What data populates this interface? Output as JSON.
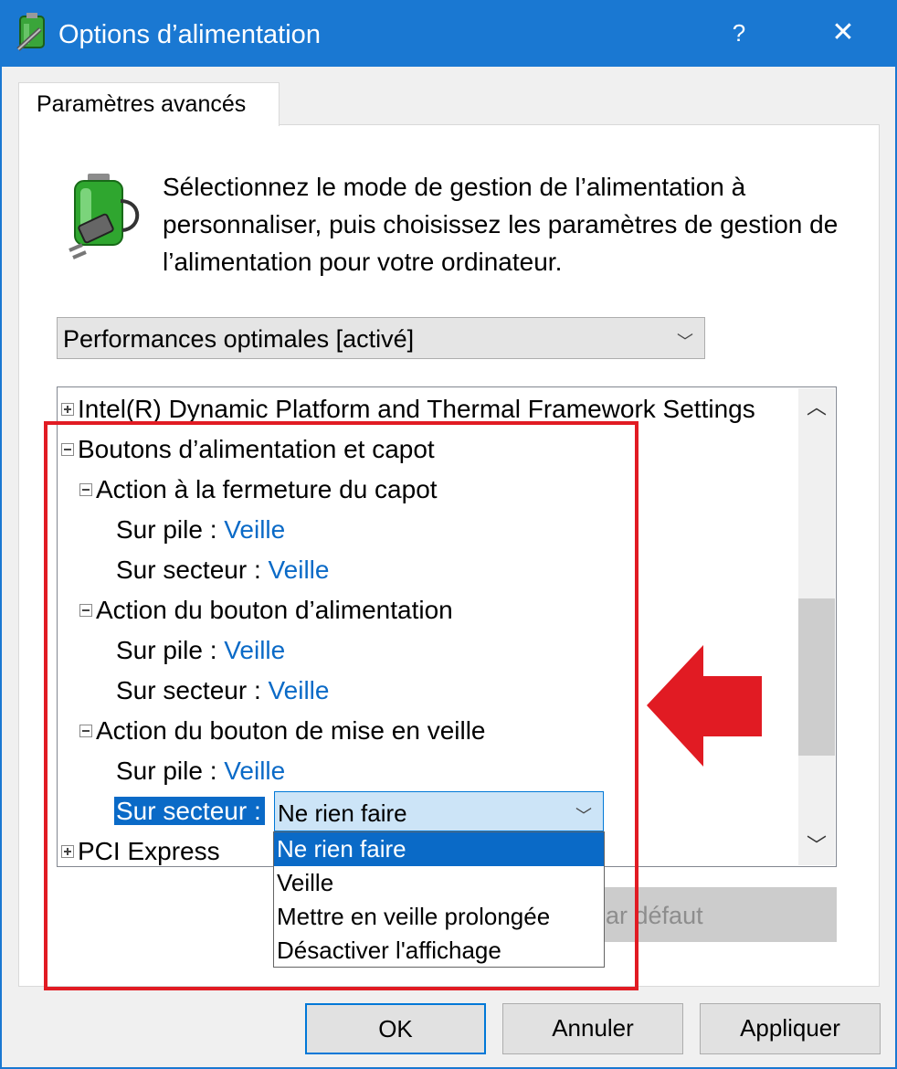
{
  "window": {
    "title": "Options d’alimentation",
    "help_label": "?",
    "close_label": "✕"
  },
  "tab": {
    "label": "Paramètres avancés"
  },
  "description": "Sélectionnez le mode de gestion de l’alimentation à personnaliser, puis choisissez les paramètres de gestion de l’alimentation pour votre ordinateur.",
  "plan_select": {
    "value": "Performances optimales [activé]"
  },
  "tree": {
    "intel": "Intel(R) Dynamic Platform and Thermal Framework Settings",
    "power_buttons": "Boutons d’alimentation et capot",
    "lid": {
      "label": "Action à la fermeture du capot",
      "battery_label": "Sur pile :",
      "battery_value": "Veille",
      "ac_label": "Sur secteur :",
      "ac_value": "Veille"
    },
    "power_button": {
      "label": "Action du bouton d’alimentation",
      "battery_label": "Sur pile :",
      "battery_value": "Veille",
      "ac_label": "Sur secteur :",
      "ac_value": "Veille"
    },
    "sleep_button": {
      "label": "Action du bouton de mise en veille",
      "battery_label": "Sur pile :",
      "battery_value": "Veille",
      "ac_label": "Sur secteur :",
      "ac_value": "Ne rien faire"
    },
    "pci": "PCI Express"
  },
  "dropdown_options": [
    "Ne rien faire",
    "Veille",
    "Mettre en veille prolongée",
    "Désactiver l'affichage"
  ],
  "restore_button": "rs par défaut",
  "buttons": {
    "ok": "OK",
    "cancel": "Annuler",
    "apply": "Appliquer"
  },
  "colors": {
    "accent": "#1a78d2",
    "link": "#0a6ac7",
    "highlight": "#e11b23"
  }
}
